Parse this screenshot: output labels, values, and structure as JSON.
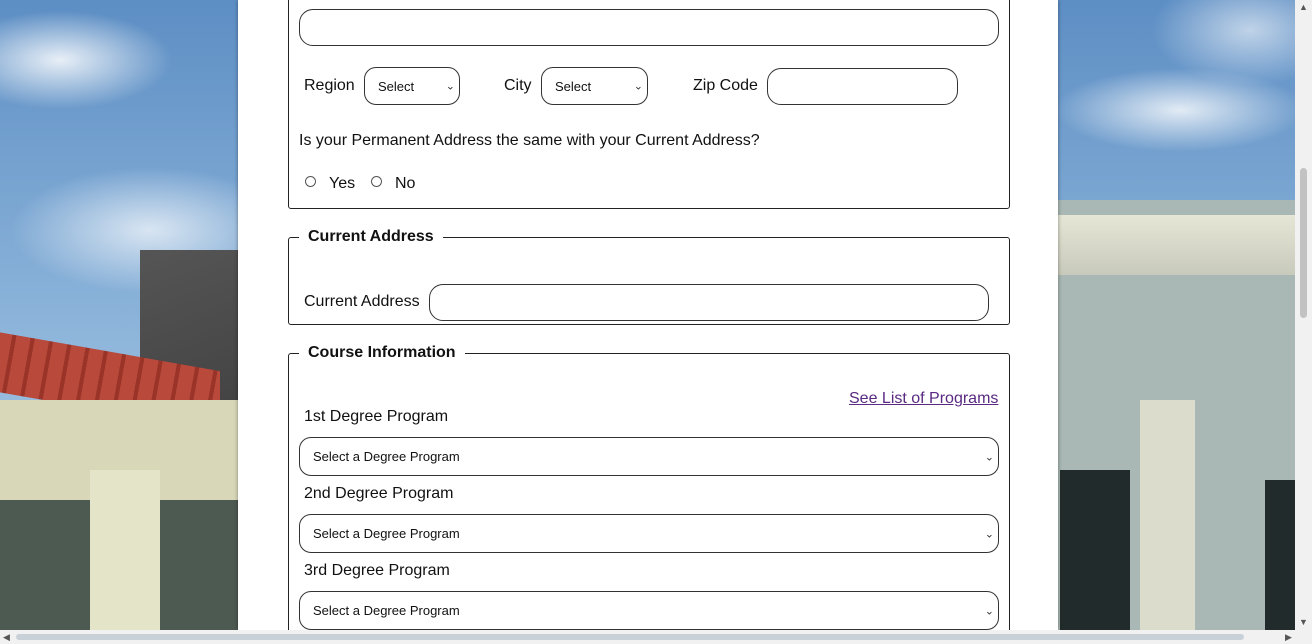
{
  "address": {
    "region_label": "Region",
    "region_value": "Select",
    "city_label": "City",
    "city_value": "Select",
    "zip_label": "Zip Code",
    "permanent_question": "Is your Permanent Address the same with your Current Address?",
    "yes_label": "Yes",
    "no_label": "No"
  },
  "current_address": {
    "legend": "Current Address",
    "label": "Current Address"
  },
  "course": {
    "legend": "Course Information",
    "programs_link": "See List of Programs",
    "first_label": "1st Degree Program",
    "first_value": "Select a Degree Program",
    "second_label": "2nd Degree Program",
    "second_value": "Select a Degree Program",
    "third_label": "3rd Degree Program",
    "third_value": "Select a Degree Program"
  },
  "icons": {
    "dropdown": "chevron-down-icon",
    "scroll_up": "scroll-up-icon",
    "scroll_down": "scroll-down-icon",
    "scroll_left": "scroll-left-icon",
    "scroll_right": "scroll-right-icon"
  },
  "colors": {
    "link": "#5a2a82",
    "border": "#222222",
    "panel": "#ffffff"
  }
}
